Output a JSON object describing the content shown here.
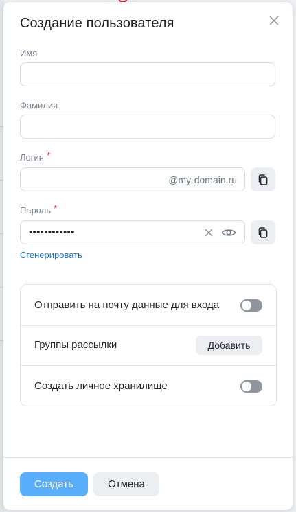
{
  "modal": {
    "title": "Создание пользователя",
    "close_icon": "close-icon"
  },
  "form": {
    "first_name": {
      "label": "Имя",
      "value": "",
      "placeholder": ""
    },
    "last_name": {
      "label": "Фамилия",
      "value": "",
      "placeholder": ""
    },
    "login": {
      "label": "Логин",
      "required_mark": "*",
      "value": "",
      "suffix": "@my-domain.ru",
      "copy_icon": "copy-icon"
    },
    "password": {
      "label": "Пароль",
      "required_mark": "*",
      "masked_value": "••••••••••••",
      "clear_icon": "close-icon",
      "reveal_icon": "eye-icon",
      "copy_icon": "copy-icon"
    },
    "generate_link": "Сгенерировать"
  },
  "options": {
    "send_credentials": {
      "label": "Отправить на почту данные для входа",
      "enabled": false
    },
    "mailing_groups": {
      "label": "Группы рассылки",
      "button": "Добавить"
    },
    "personal_storage": {
      "label": "Создать личное хранилище",
      "enabled": false
    }
  },
  "footer": {
    "create_button": "Создать",
    "cancel_button": "Отмена"
  },
  "colors": {
    "primary": "#5aaefc",
    "link": "#1a73c8",
    "required": "#e0253a",
    "toggle_off": "#8f959d"
  }
}
